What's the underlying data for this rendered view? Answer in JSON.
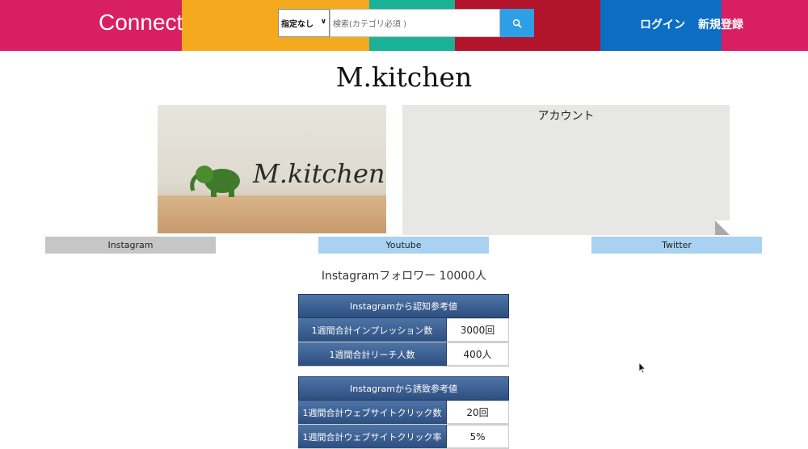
{
  "header": {
    "logo": "Connect",
    "search_select": "指定なし",
    "search_placeholder": "検索(カテゴリ必須 )",
    "login": "ログイン",
    "signup": "新規登録",
    "colors": [
      "#d81f62",
      "#f5a91f",
      "#1ab297",
      "#b2142c",
      "#0b6ec3"
    ]
  },
  "profile": {
    "name": "M.kitchen",
    "photo_text": "M.kitchen",
    "account_label": "アカウント"
  },
  "tabs": [
    {
      "label": "Instagram"
    },
    {
      "label": "Youtube"
    },
    {
      "label": "Twitter"
    }
  ],
  "followers": "Instagramフォロワー 10000人",
  "tables": [
    {
      "title": "Instagramから認知参考値",
      "rows": [
        {
          "label": "1週間合計インプレッション数",
          "value": "3000回"
        },
        {
          "label": "1週間合計リーチ人数",
          "value": "400人"
        }
      ]
    },
    {
      "title": "Instagramから誘致参考値",
      "rows": [
        {
          "label": "1週間合計ウェブサイトクリック数",
          "value": "20回"
        },
        {
          "label": "1週間合計ウェブサイトクリック率",
          "value": "5%"
        }
      ]
    }
  ]
}
